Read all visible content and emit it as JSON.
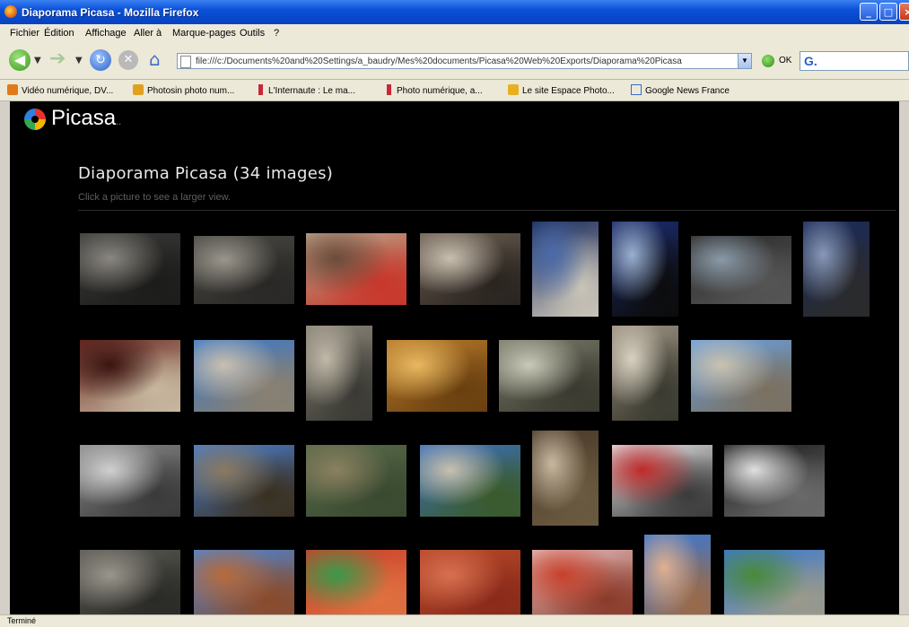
{
  "window": {
    "title": "Diaporama Picasa - Mozilla Firefox"
  },
  "menu": [
    "Fichier",
    "Édition",
    "Affichage",
    "Aller à",
    "Marque-pages",
    "Outils",
    "?"
  ],
  "navbar": {
    "url": "file:///c:/Documents%20and%20Settings/a_baudry/Mes%20documents/Picasa%20Web%20Exports/Diaporama%20Picasa",
    "go_label": "OK",
    "search_logo": "G."
  },
  "bookmarks": [
    {
      "label": "Vidéo numérique, DV...",
      "icon": "rss-icon",
      "color": "#e07a1a"
    },
    {
      "label": "Photosin photo num...",
      "icon": "folder-icon",
      "color": "#e0a020"
    },
    {
      "label": "L'Internaute : Le ma...",
      "icon": "page-icon",
      "color": "#c8283a"
    },
    {
      "label": "Photo numérique, a...",
      "icon": "page-icon",
      "color": "#c8283a"
    },
    {
      "label": "Le site Espace Photo...",
      "icon": "star-icon",
      "color": "#e8b020"
    },
    {
      "label": "Google News France",
      "icon": "google-icon",
      "color": "#3a6ad0"
    }
  ],
  "page": {
    "brand": "Picasa",
    "brand_suffix": "..",
    "heading": "Diaporama Picasa (34 images)",
    "subtitle": "Click a picture to see a larger view."
  },
  "status": "Terminé",
  "thumbnails": [
    {
      "row": 0,
      "colors": [
        "#3b3a38",
        "#8a8780",
        "#1c1c1a"
      ]
    },
    {
      "row": 0,
      "colors": [
        "#4a4844",
        "#9a968c",
        "#2a2826"
      ]
    },
    {
      "row": 0,
      "colors": [
        "#b8a58a",
        "#6a4b3a",
        "#c8362a"
      ]
    },
    {
      "row": 0,
      "colors": [
        "#6a5e50",
        "#c9bfb0",
        "#2a2420"
      ]
    },
    {
      "row": 0,
      "colors": [
        "#1a2b5c",
        "#4a6aa8",
        "#c9c4b8"
      ]
    },
    {
      "row": 0,
      "colors": [
        "#1b2b6c",
        "#9ab0d0",
        "#0c0c0c"
      ]
    },
    {
      "row": 0,
      "colors": [
        "#2a2a2a",
        "#8a9aa8",
        "#555"
      ]
    },
    {
      "row": 0,
      "colors": [
        "#1a2a5a",
        "#8898b8",
        "#2b2b2b"
      ]
    },
    {
      "row": 1,
      "colors": [
        "#6a2a22",
        "#3a1410",
        "#c8b8a0"
      ]
    },
    {
      "row": 1,
      "colors": [
        "#3a78c8",
        "#c9c0b0",
        "#8a8070"
      ]
    },
    {
      "row": 1,
      "colors": [
        "#8a8478",
        "#c0b8a8",
        "#3a3a34"
      ]
    },
    {
      "row": 1,
      "colors": [
        "#b87a2a",
        "#e8b860",
        "#6a4010"
      ]
    },
    {
      "row": 1,
      "colors": [
        "#7a7a6a",
        "#c9c9b8",
        "#3a3a30"
      ]
    },
    {
      "row": 1,
      "colors": [
        "#9a9080",
        "#d8d0c0",
        "#3a3a30"
      ]
    },
    {
      "row": 1,
      "colors": [
        "#6aa0e0",
        "#c9c2b0",
        "#7a7060"
      ]
    },
    {
      "row": 2,
      "colors": [
        "#8a8a8a",
        "#d0d0d0",
        "#3a3a3a"
      ]
    },
    {
      "row": 2,
      "colors": [
        "#4a80d0",
        "#8a7a60",
        "#3a3020"
      ]
    },
    {
      "row": 2,
      "colors": [
        "#5a6a4a",
        "#8a8060",
        "#3a4a30"
      ]
    },
    {
      "row": 2,
      "colors": [
        "#3a70c0",
        "#c8c0b0",
        "#3a5a2a"
      ]
    },
    {
      "row": 2,
      "colors": [
        "#4a3a2a",
        "#c8b8a0",
        "#6a5a40"
      ]
    },
    {
      "row": 2,
      "colors": [
        "#e8e8ea",
        "#c02a2a",
        "#3a3a3a"
      ]
    },
    {
      "row": 2,
      "colors": [
        "#1a1a1a",
        "#e0e0e0",
        "#6a6a6a"
      ]
    },
    {
      "row": 3,
      "colors": [
        "#5a5a54",
        "#9a968c",
        "#2a2a26"
      ]
    },
    {
      "row": 3,
      "colors": [
        "#4a88d8",
        "#b86a3a",
        "#8a4a2a"
      ]
    },
    {
      "row": 3,
      "colors": [
        "#c8402a",
        "#3a9a4a",
        "#e07040"
      ]
    },
    {
      "row": 3,
      "colors": [
        "#b84a2a",
        "#d87050",
        "#8a2a1a"
      ]
    },
    {
      "row": 3,
      "colors": [
        "#e8c0c0",
        "#c8402a",
        "#8a3a2a"
      ]
    },
    {
      "row": 3,
      "colors": [
        "#3a78d0",
        "#e0b090",
        "#9a6a4a"
      ]
    },
    {
      "row": 3,
      "colors": [
        "#3a78d0",
        "#4a8a3a",
        "#9a9a8a"
      ]
    }
  ]
}
